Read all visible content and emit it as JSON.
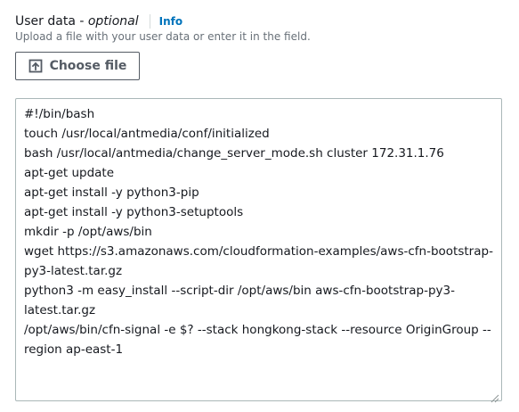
{
  "field": {
    "label": "User data",
    "separator": " - ",
    "optional": "optional",
    "info_link": "Info",
    "description": "Upload a file with your user data or enter it in the field."
  },
  "upload_button": {
    "label": "Choose file",
    "icon": "upload-icon"
  },
  "user_data": {
    "lines": [
      "#!/bin/bash",
      "touch /usr/local/antmedia/conf/initialized",
      "bash /usr/local/antmedia/change_server_mode.sh cluster 172.31.1.76",
      "apt-get update",
      "apt-get install -y python3-pip",
      "apt-get install -y python3-setuptools",
      "mkdir -p /opt/aws/bin",
      "wget https://s3.amazonaws.com/cloudformation-examples/aws-cfn-bootstrap-",
      "py3-latest.tar.gz",
      "python3 -m easy_install --script-dir /opt/aws/bin aws-cfn-bootstrap-py3-",
      "latest.tar.gz",
      "/opt/aws/bin/cfn-signal -e $? --stack hongkong-stack --resource OriginGroup --",
      "region ap-east-1"
    ]
  },
  "colors": {
    "text": "#16191f",
    "muted": "#687078",
    "link": "#0073bb",
    "button_border": "#545b64",
    "input_border": "#aab7b8"
  }
}
